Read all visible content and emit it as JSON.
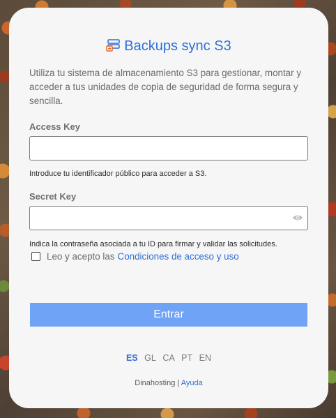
{
  "app": {
    "title": "Backups sync S3",
    "description": "Utiliza tu sistema de almacenamiento S3 para gestionar, montar y acceder a tus unidades de copia de seguridad de forma segura y sencilla."
  },
  "form": {
    "access_key": {
      "label": "Access Key",
      "value": "",
      "hint": "Introduce tu identificador público para acceder a S3."
    },
    "secret_key": {
      "label": "Secret Key",
      "value": "",
      "hint": "Indica la contraseña asociada a tu ID para firmar y validar las solicitudes."
    },
    "terms": {
      "checked": false,
      "text": "Leo y acepto las",
      "link_text": "Condiciones de acceso y uso"
    },
    "submit_label": "Entrar"
  },
  "languages": {
    "items": [
      "ES",
      "GL",
      "CA",
      "PT",
      "EN"
    ],
    "active": "ES"
  },
  "footer": {
    "brand": "Dinahosting",
    "separator": "|",
    "help": "Ayuda"
  },
  "colors": {
    "accent": "#2f6fd6",
    "button": "#6ea3f6",
    "card": "#f6f6f6"
  },
  "icons": {
    "logo": "server-sync-icon",
    "password_toggle": "eye-icon"
  }
}
